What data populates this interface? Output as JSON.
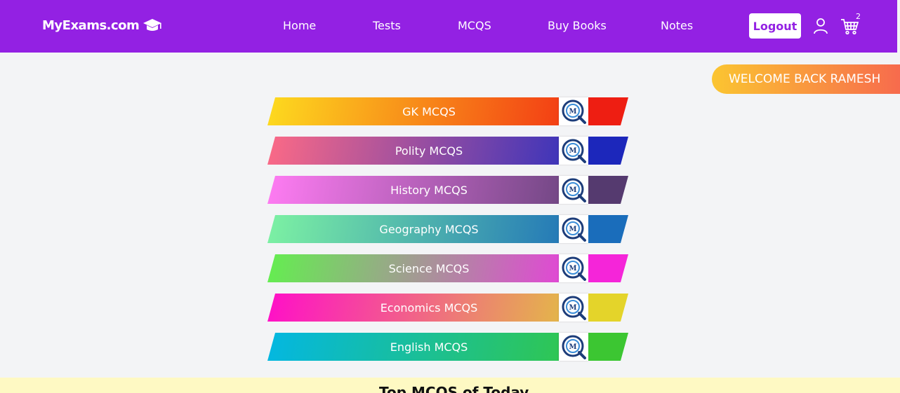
{
  "header": {
    "brand": "MyExams.com",
    "nav": [
      "Home",
      "Tests",
      "MCQS",
      "Buy Books",
      "Notes"
    ],
    "logout_label": "Logout",
    "cart_count": "2"
  },
  "welcome": "WELCOME BACK RAMESH",
  "mcq_list": [
    {
      "label": "GK MCQS",
      "from": "#fddb1f",
      "to": "#f33f14",
      "tail": "#ee1e12"
    },
    {
      "label": "Polity MCQS",
      "from": "#fc6a86",
      "to": "#3f35b9",
      "tail": "#1c27bb"
    },
    {
      "label": "History MCQS",
      "from": "#ff7cf3",
      "to": "#744886",
      "tail": "#553a6f"
    },
    {
      "label": "Geography MCQS",
      "from": "#7df2a3",
      "to": "#257ab7",
      "tail": "#1a6dbb"
    },
    {
      "label": "Science MCQS",
      "from": "#63ef4f",
      "to": "#e049d4",
      "tail": "#f525d9"
    },
    {
      "label": "Economics MCQS",
      "from": "#ff0fc8",
      "to": "#e4b44b",
      "tail": "#e4d42a"
    },
    {
      "label": "English MCQS",
      "from": "#03b7e2",
      "to": "#2fc654",
      "tail": "#3cc632"
    }
  ],
  "bottom_title": "Top MCQS of Today"
}
